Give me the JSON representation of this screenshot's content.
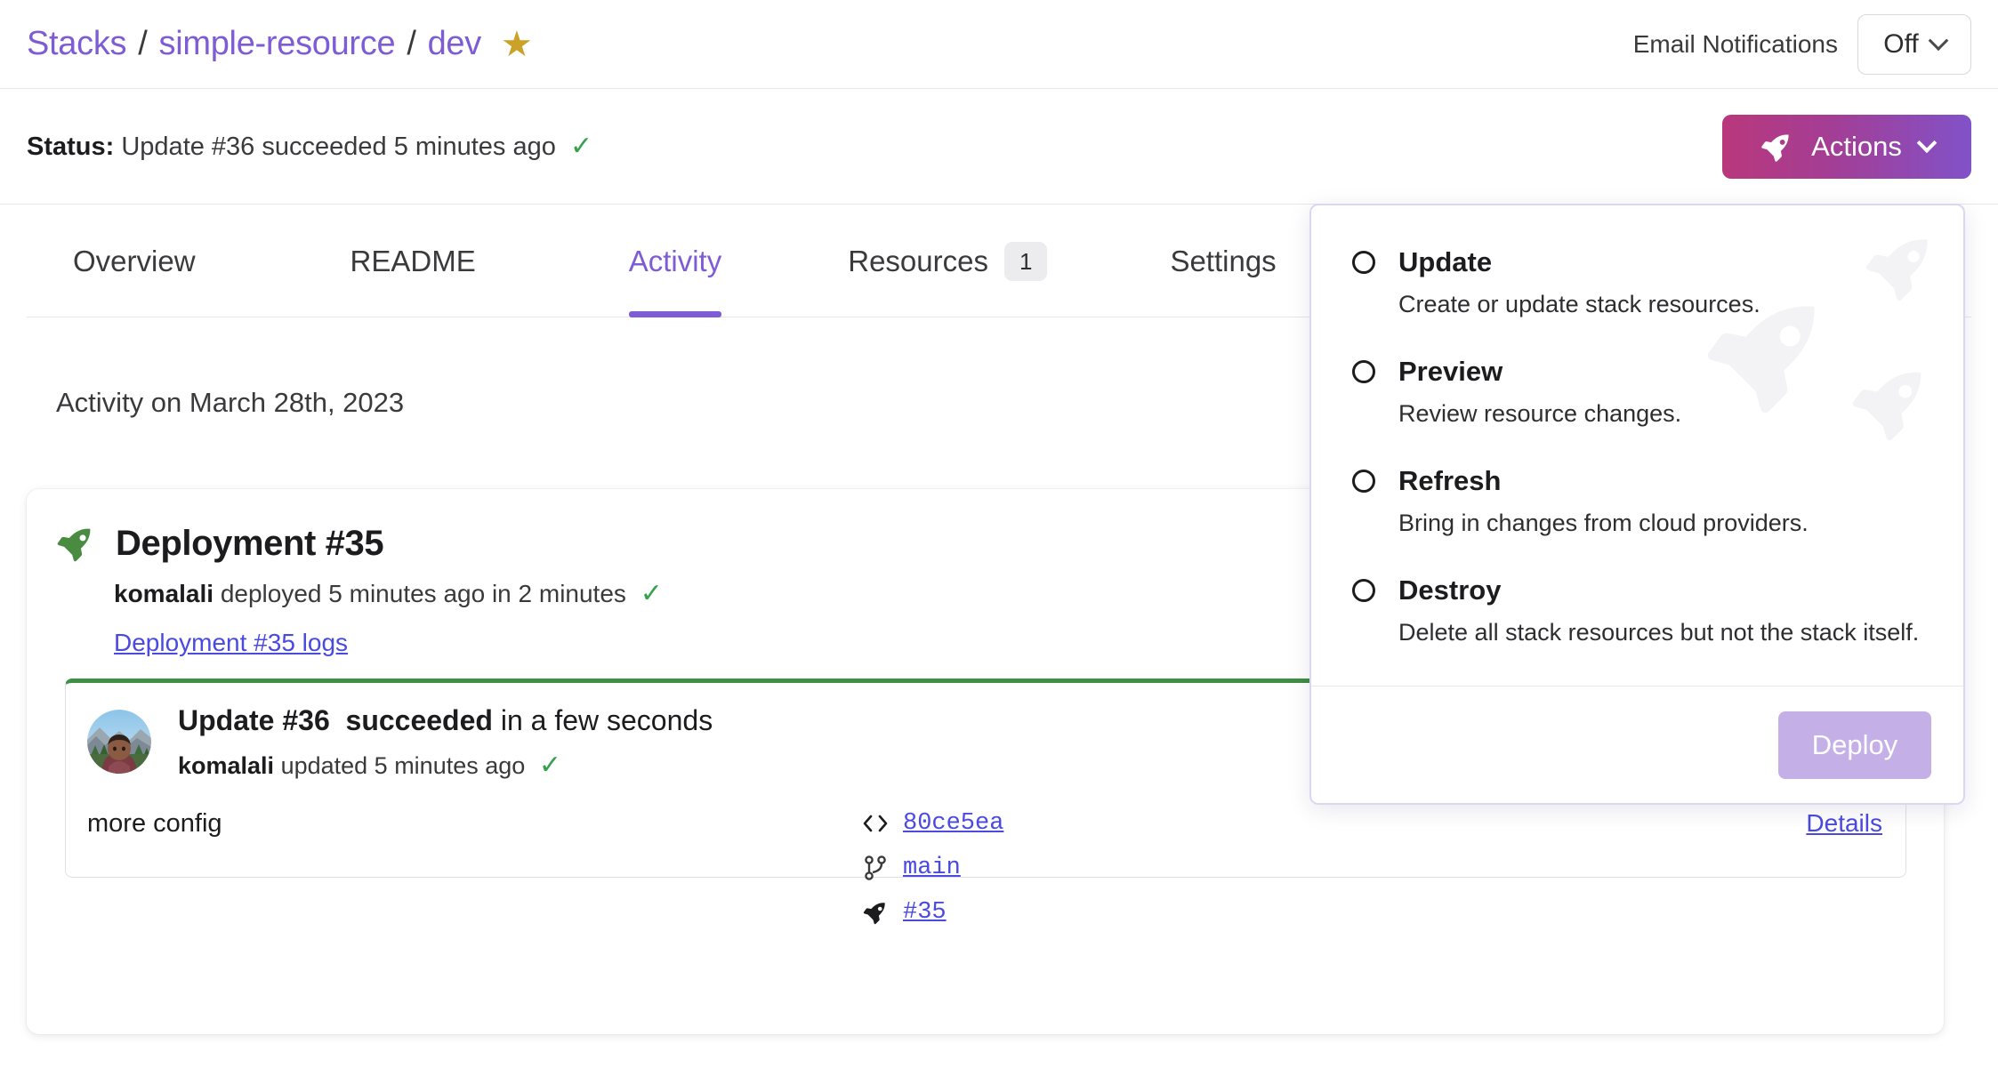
{
  "breadcrumb": {
    "stacks": "Stacks",
    "project": "simple-resource",
    "stack": "dev",
    "sep": "/",
    "star": "★"
  },
  "header": {
    "email_notifications_label": "Email Notifications",
    "email_notifications_value": "Off"
  },
  "status": {
    "label": "Status:",
    "text": "Update #36 succeeded 5 minutes ago",
    "check": "✓"
  },
  "actions_button": {
    "label": "Actions",
    "gradient_from": "#b9387c",
    "gradient_to": "#8152c8"
  },
  "tabs": [
    {
      "label": "Overview",
      "active": false,
      "badge": ""
    },
    {
      "label": "README",
      "active": false,
      "badge": ""
    },
    {
      "label": "Activity",
      "active": true,
      "badge": ""
    },
    {
      "label": "Resources",
      "active": false,
      "badge": "1"
    },
    {
      "label": "Settings",
      "active": false,
      "badge": ""
    }
  ],
  "activity": {
    "date_heading": "Activity on March 28th, 2023",
    "deployment": {
      "title": "Deployment #35",
      "actor": "komalali",
      "sub_text": "deployed 5 minutes ago in 2 minutes",
      "check": "✓",
      "logs_link": "Deployment #35 logs"
    },
    "update": {
      "title_prefix": "Update #36",
      "status_word": "succeeded",
      "duration": "in a few seconds",
      "actor": "komalali",
      "sub_text": "updated 5 minutes ago",
      "check": "✓",
      "commit_message": "more config",
      "commit_hash": "80ce5ea",
      "branch": "main",
      "deployment_ref": "#35",
      "details_link": "Details",
      "accent_color": "#3f8f45"
    }
  },
  "dropdown": {
    "items": [
      {
        "label": "Update",
        "description": "Create or update stack resources."
      },
      {
        "label": "Preview",
        "description": "Review resource changes."
      },
      {
        "label": "Refresh",
        "description": "Bring in changes from cloud providers."
      },
      {
        "label": "Destroy",
        "description": "Delete all stack resources but not the stack itself."
      }
    ],
    "deploy_label": "Deploy"
  }
}
